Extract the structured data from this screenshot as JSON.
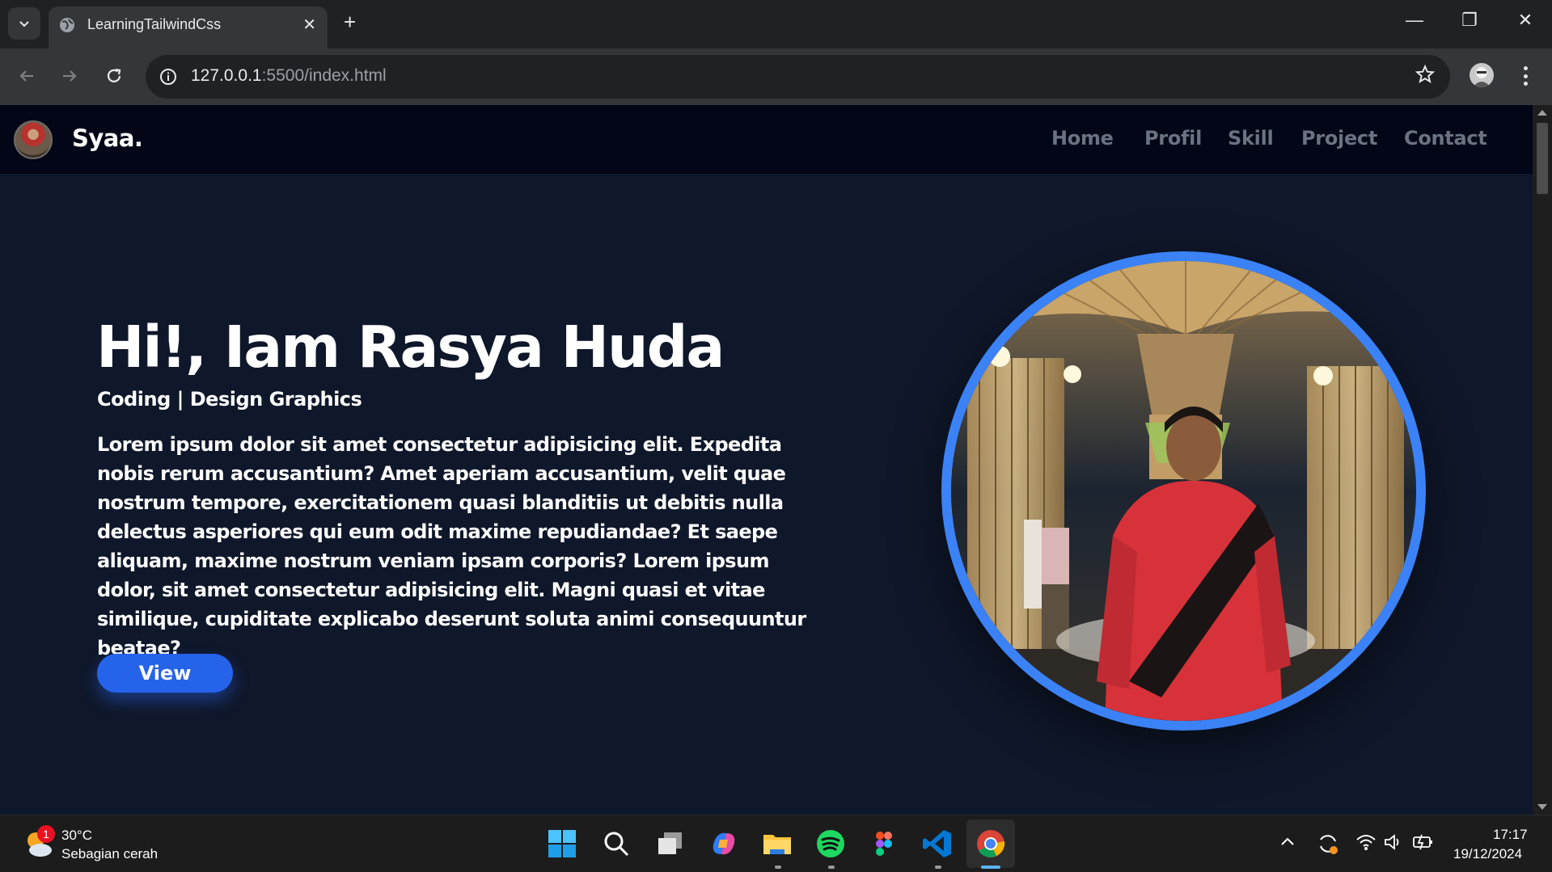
{
  "browser": {
    "tab_title": "LearningTailwindCss",
    "tab_close": "✕",
    "new_tab": "+",
    "url_host": "127.0.0.1",
    "url_rest": ":5500/index.html",
    "window_controls": {
      "minimize": "—",
      "restore": "❐",
      "close": "✕"
    }
  },
  "site": {
    "brand": "Syaa.",
    "nav": [
      "Home",
      "Profil",
      "Skill",
      "Project",
      "Contact"
    ],
    "hero": {
      "title": "Hi!, Iam Rasya Huda",
      "subtitle": "Coding | Design Graphics",
      "description": "Lorem ipsum dolor sit amet consectetur adipisicing elit. Expedita nobis rerum accusantium? Amet aperiam accusantium, velit quae nostrum tempore, exercitationem quasi blanditiis ut debitis nulla delectus asperiores qui eum odit maxime repudiandae? Et saepe aliquam, maxime nostrum veniam ipsam corporis? Lorem ipsum dolor, sit amet consectetur adipisicing elit. Magni quasi et vitae similique, cupiditate explicabo deserunt soluta animi consequuntur beatae?",
      "button": "View"
    },
    "colors": {
      "page_bg": "#0f172a",
      "nav_bg": "#020617",
      "accent": "#2563eb",
      "ring": "#3b82f6"
    }
  },
  "taskbar": {
    "weather_badge": "1",
    "weather_temp": "30°C",
    "weather_desc": "Sebagian cerah",
    "apps": [
      "start-icon",
      "search-icon",
      "task-view-icon",
      "copilot-icon",
      "file-explorer-icon",
      "spotify-icon",
      "figma-icon",
      "vscode-icon",
      "chrome-icon"
    ],
    "clock_time": "17:17",
    "clock_date": "19/12/2024"
  }
}
